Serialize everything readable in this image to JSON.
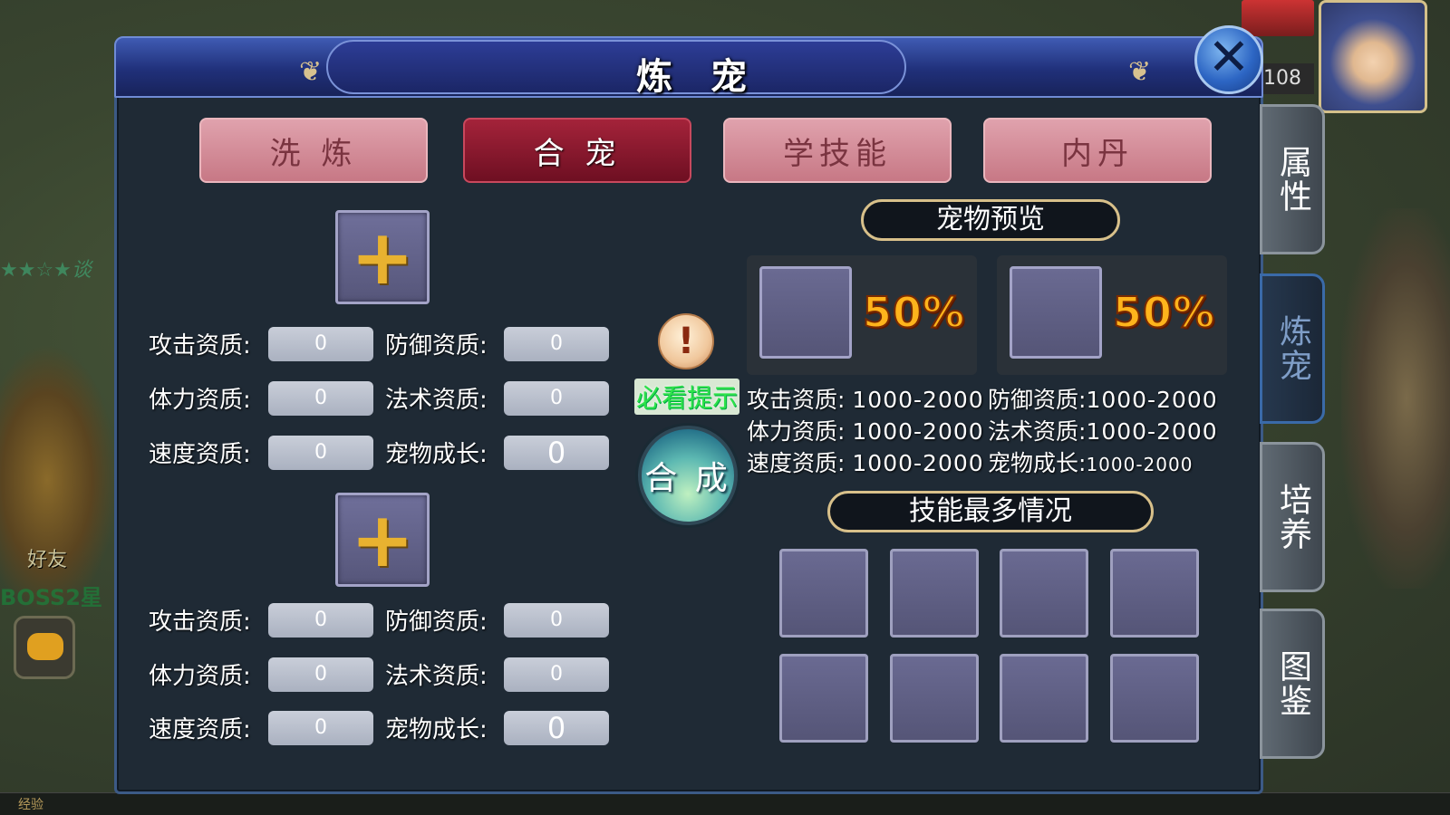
{
  "background": {
    "left_text": "★★☆★谈",
    "friend_label": "好友",
    "boss_text": "BOSS2星",
    "level": "108",
    "exp_label": "经验"
  },
  "dialog": {
    "title": "炼 宠",
    "close_icon": "close-x-icon"
  },
  "tabs": [
    {
      "label": "洗 炼",
      "active": false
    },
    {
      "label": "合 宠",
      "active": true
    },
    {
      "label": "学技能",
      "active": false
    },
    {
      "label": "内丹",
      "active": false
    }
  ],
  "side_tabs": [
    {
      "label": "属性",
      "active": false
    },
    {
      "label": "炼宠",
      "active": true
    },
    {
      "label": "培养",
      "active": false
    },
    {
      "label": "图鉴",
      "active": false
    }
  ],
  "pet1": {
    "attack_label": "攻击资质:",
    "attack": "0",
    "defense_label": "防御资质:",
    "defense": "0",
    "stamina_label": "体力资质:",
    "stamina": "0",
    "magic_label": "法术资质:",
    "magic": "0",
    "speed_label": "速度资质:",
    "speed": "0",
    "growth_label": "宠物成长:",
    "growth": "0"
  },
  "pet2": {
    "attack_label": "攻击资质:",
    "attack": "0",
    "defense_label": "防御资质:",
    "defense": "0",
    "stamina_label": "体力资质:",
    "stamina": "0",
    "magic_label": "法术资质:",
    "magic": "0",
    "speed_label": "速度资质:",
    "speed": "0",
    "growth_label": "宠物成长:",
    "growth": "0"
  },
  "middle": {
    "hint_icon": "!",
    "hint_text": "必看提示",
    "compose_label": "合 成"
  },
  "preview": {
    "title": "宠物预览",
    "left_pct": "50%",
    "right_pct": "50%",
    "attack_label": "攻击资质:",
    "attack": "1000-2000",
    "defense_label": "防御资质:",
    "defense": "1000-2000",
    "stamina_label": "体力资质:",
    "stamina": "1000-2000",
    "magic_label": "法术资质:",
    "magic": "1000-2000",
    "speed_label": "速度资质:",
    "speed": "1000-2000",
    "growth_label": "宠物成长:",
    "growth": "1000-2000"
  },
  "skills": {
    "title": "技能最多情况"
  },
  "colors": {
    "title_bar": "#2d3d96",
    "active_tab": "#a4233a",
    "inactive_tab": "#d48f9b",
    "percent": "#ffb41c",
    "hint_text": "#2ee24a"
  }
}
